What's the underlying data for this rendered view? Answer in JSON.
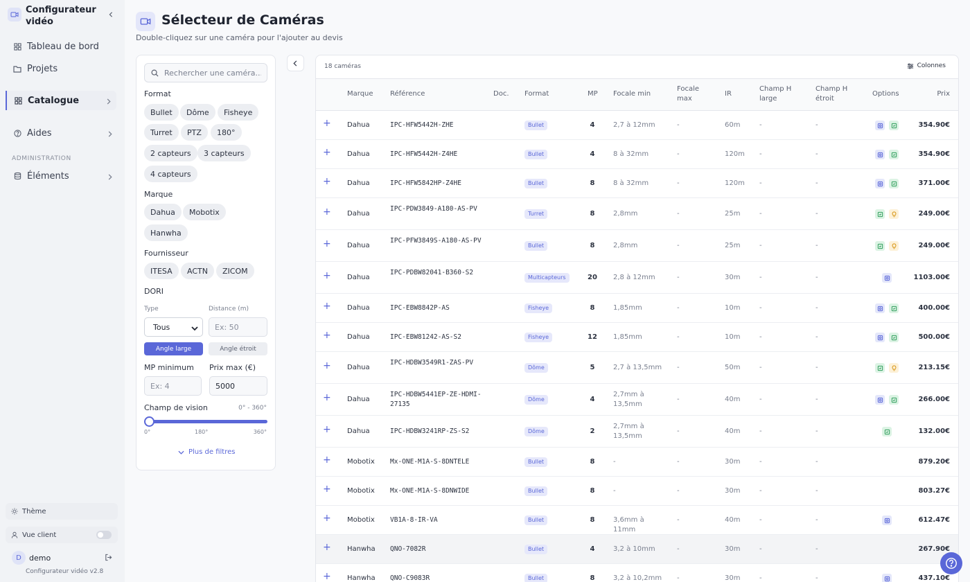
{
  "app": {
    "title": "Configurateur vidéo",
    "version": "Configurateur vidéo v2.8"
  },
  "nav": {
    "dashboard": "Tableau de bord",
    "projects": "Projets",
    "catalog": "Catalogue",
    "help": "Aides",
    "admin_section": "ADMINISTRATION",
    "elements": "Éléments"
  },
  "sidebar_footer": {
    "theme": "Thème",
    "client_view": "Vue client",
    "user_initial": "D",
    "user_name": "demo"
  },
  "page": {
    "title": "Sélecteur de Caméras",
    "subtitle": "Double-cliquez sur une caméra pour l'ajouter au devis"
  },
  "filters": {
    "search_placeholder": "Rechercher une caméra...",
    "format_label": "Format",
    "formats": [
      "Bullet",
      "Dôme",
      "Fisheye",
      "Turret",
      "PTZ",
      "180°",
      "2 capteurs",
      "3 capteurs",
      "4 capteurs"
    ],
    "brand_label": "Marque",
    "brands": [
      "Dahua",
      "Mobotix",
      "Hanwha"
    ],
    "supplier_label": "Fournisseur",
    "suppliers": [
      "ITESA",
      "ACTN",
      "ZICOM"
    ],
    "dori_label": "DORI",
    "type_label": "Type",
    "type_value": "Tous",
    "distance_label": "Distance (m)",
    "distance_placeholder": "Ex: 50",
    "angle_wide": "Angle large",
    "angle_narrow": "Angle étroit",
    "mp_min_label": "MP minimum",
    "mp_placeholder": "Ex: 4",
    "price_max_label": "Prix max (€)",
    "price_max_value": "5000",
    "fov_label": "Champ de vision",
    "fov_range": "0° - 360°",
    "fov_ticks": [
      "0°",
      "180°",
      "360°"
    ],
    "more_filters": "Plus de filtres"
  },
  "table": {
    "count": "18 caméras",
    "columns_button": "Colonnes",
    "headers": {
      "brand": "Marque",
      "reference": "Référence",
      "doc": "Doc.",
      "format": "Format",
      "mp": "MP",
      "focal_min": "Focale min",
      "focal_max": "Focale max",
      "ir": "IR",
      "fov_wide": "Champ H large",
      "fov_narrow": "Champ H étroit",
      "options": "Options",
      "price": "Prix"
    },
    "rows": [
      {
        "plus": "+",
        "brand": "Dahua",
        "ref": "IPC-HFW5442H-ZHE",
        "format": "Bullet",
        "mp": "4",
        "fmin": "2,7 à 12mm",
        "fmax": "-",
        "ir": "60m",
        "wide": "-",
        "narrow": "-",
        "opts": [
          "cam",
          "shield"
        ],
        "price": "354.90€"
      },
      {
        "plus": "+",
        "brand": "Dahua",
        "ref": "IPC-HFW5442H-Z4HE",
        "format": "Bullet",
        "mp": "4",
        "fmin": "8 à 32mm",
        "fmax": "-",
        "ir": "120m",
        "wide": "-",
        "narrow": "-",
        "opts": [
          "cam",
          "shield"
        ],
        "price": "354.90€"
      },
      {
        "plus": "+",
        "brand": "Dahua",
        "ref": "IPC-HFW5842HP-Z4HE",
        "format": "Bullet",
        "mp": "8",
        "fmin": "8 à 32mm",
        "fmax": "-",
        "ir": "120m",
        "wide": "-",
        "narrow": "-",
        "opts": [
          "cam",
          "shield"
        ],
        "price": "371.00€"
      },
      {
        "plus": "+",
        "brand": "Dahua",
        "ref": "IPC-PDW3849-A180-AS-PV",
        "format": "Turret",
        "mp": "8",
        "fmin": "2,8mm",
        "fmax": "-",
        "ir": "25m",
        "wide": "-",
        "narrow": "-",
        "opts": [
          "shield",
          "bulb"
        ],
        "price": "249.00€"
      },
      {
        "plus": "+",
        "brand": "Dahua",
        "ref": "IPC-PFW3849S-A180-AS-PV",
        "format": "Bullet",
        "mp": "8",
        "fmin": "2,8mm",
        "fmax": "-",
        "ir": "25m",
        "wide": "-",
        "narrow": "-",
        "opts": [
          "shield",
          "bulb"
        ],
        "price": "249.00€"
      },
      {
        "plus": "+",
        "brand": "Dahua",
        "ref": "IPC-PDBW82041-B360-S2",
        "format": "Multicapteurs",
        "mp": "20",
        "fmin": "2,8 à 12mm",
        "fmax": "-",
        "ir": "30m",
        "wide": "-",
        "narrow": "-",
        "opts": [
          "cam"
        ],
        "price": "1103.00€"
      },
      {
        "plus": "+",
        "brand": "Dahua",
        "ref": "IPC-EBW8842P-AS",
        "format": "Fisheye",
        "mp": "8",
        "fmin": "1,85mm",
        "fmax": "-",
        "ir": "10m",
        "wide": "-",
        "narrow": "-",
        "opts": [
          "cam",
          "shield"
        ],
        "price": "400.00€"
      },
      {
        "plus": "+",
        "brand": "Dahua",
        "ref": "IPC-EBW81242-AS-S2",
        "format": "Fisheye",
        "mp": "12",
        "fmin": "1,85mm",
        "fmax": "-",
        "ir": "10m",
        "wide": "-",
        "narrow": "-",
        "opts": [
          "cam",
          "shield"
        ],
        "price": "500.00€"
      },
      {
        "plus": "+",
        "brand": "Dahua",
        "ref": "IPC-HDBW3549R1-ZAS-PV",
        "format": "Dôme",
        "mp": "5",
        "fmin": "2,7 à 13,5mm",
        "fmax": "-",
        "ir": "50m",
        "wide": "-",
        "narrow": "-",
        "opts": [
          "shield",
          "bulb"
        ],
        "price": "213.15€"
      },
      {
        "plus": "+",
        "brand": "Dahua",
        "ref": "IPC-HDBW5441EP-ZE-HDMI-27135",
        "format": "Dôme",
        "mp": "4",
        "fmin": "2,7mm à 13,5mm",
        "fmax": "-",
        "ir": "40m",
        "wide": "-",
        "narrow": "-",
        "opts": [
          "cam",
          "shield"
        ],
        "price": "266.00€"
      },
      {
        "plus": "+",
        "brand": "Dahua",
        "ref": "IPC-HDBW3241RP-ZS-S2",
        "format": "Dôme",
        "mp": "2",
        "fmin": "2,7mm à 13,5mm",
        "fmax": "-",
        "ir": "40m",
        "wide": "-",
        "narrow": "-",
        "opts": [
          "shield"
        ],
        "price": "132.00€"
      },
      {
        "plus": "+",
        "brand": "Mobotix",
        "ref": "Mx-ONE-M1A-S-8DNTELE",
        "format": "Bullet",
        "mp": "8",
        "fmin": "-",
        "fmax": "-",
        "ir": "30m",
        "wide": "-",
        "narrow": "-",
        "opts": [],
        "price": "879.20€"
      },
      {
        "plus": "+",
        "brand": "Mobotix",
        "ref": "Mx-ONE-M1A-S-8DNWIDE",
        "format": "Bullet",
        "mp": "8",
        "fmin": "-",
        "fmax": "-",
        "ir": "30m",
        "wide": "-",
        "narrow": "-",
        "opts": [],
        "price": "803.27€"
      },
      {
        "plus": "+",
        "brand": "Mobotix",
        "ref": "VB1A-8-IR-VA",
        "format": "Bullet",
        "mp": "8",
        "fmin": "3,6mm à 11mm",
        "fmax": "-",
        "ir": "40m",
        "wide": "-",
        "narrow": "-",
        "opts": [
          "cam"
        ],
        "price": "612.47€"
      },
      {
        "plus": "+",
        "brand": "Hanwha",
        "ref": "QNO-7082R",
        "format": "Bullet",
        "mp": "4",
        "fmin": "3,2 à 10mm",
        "fmax": "-",
        "ir": "30m",
        "wide": "-",
        "narrow": "-",
        "opts": [],
        "price": "267.90€"
      },
      {
        "plus": "+",
        "brand": "Hanwha",
        "ref": "QNO-C9083R",
        "format": "Bullet",
        "mp": "8",
        "fmin": "3,2 à 10,2mm",
        "fmax": "-",
        "ir": "30m",
        "wide": "-",
        "narrow": "-",
        "opts": [
          "cam"
        ],
        "price": "437.10€"
      }
    ]
  },
  "colors": {
    "accent": "#5a67d8",
    "sidebar_bg": "#f1f3f6",
    "option_camera": "#e4e7fa",
    "option_shield": "#dcf3e4",
    "option_bulb": "#fdf1d8"
  }
}
